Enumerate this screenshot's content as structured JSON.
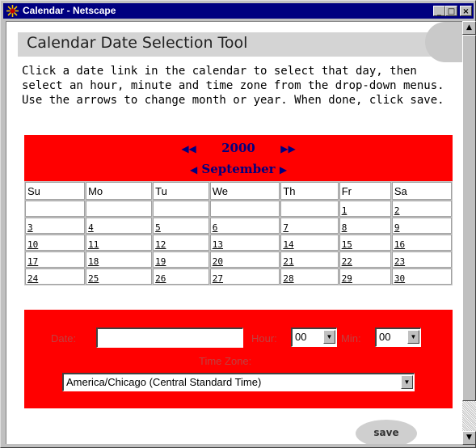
{
  "window": {
    "title": "Calendar - Netscape",
    "controls": [
      "minimize",
      "maximize",
      "close"
    ]
  },
  "page": {
    "heading": "Calendar Date Selection Tool",
    "instructions": "Click a date link in the calendar to select that day, then select an hour, minute and time zone from the drop-down menus. Use the arrows to change month or year. When done, click save."
  },
  "calendar": {
    "year": "2000",
    "month": "September",
    "weekdays": [
      "Su",
      "Mo",
      "Tu",
      "We",
      "Th",
      "Fr",
      "Sa"
    ],
    "weeks": [
      [
        "",
        "",
        "",
        "",
        "",
        "1",
        "2"
      ],
      [
        "3",
        "4",
        "5",
        "6",
        "7",
        "8",
        "9"
      ],
      [
        "10",
        "11",
        "12",
        "13",
        "14",
        "15",
        "16"
      ],
      [
        "17",
        "18",
        "19",
        "20",
        "21",
        "22",
        "23"
      ],
      [
        "24",
        "25",
        "26",
        "27",
        "28",
        "29",
        "30"
      ]
    ]
  },
  "form": {
    "date_label": "Date:",
    "date_value": "",
    "hour_label": "Hour:",
    "hour_value": "00",
    "min_label": "Min:",
    "min_value": "00",
    "timezone_label": "Time Zone:",
    "timezone_value": "America/Chicago (Central Standard Time)"
  },
  "actions": {
    "save_label": "save"
  },
  "colors": {
    "titlebar": "#000080",
    "panel_red": "#ff0000",
    "nav_text": "#000080"
  }
}
